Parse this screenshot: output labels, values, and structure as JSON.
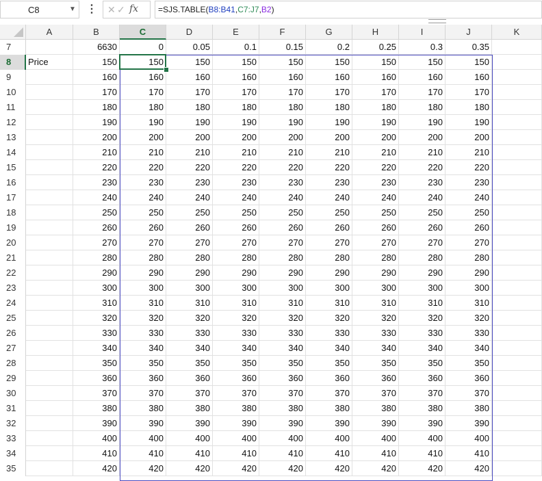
{
  "formula_bar": {
    "name_box": "C8",
    "cancel_glyph": "✕",
    "enter_glyph": "✓",
    "fx_label": "fx",
    "formula_prefix": "=SJS.TABLE(",
    "formula_ref1": "B8:B41",
    "formula_sep1": ",",
    "formula_ref2": "C7:J7",
    "formula_sep2": ",",
    "formula_ref3": "B2",
    "formula_suffix": ")"
  },
  "sheet": {
    "columns": [
      "A",
      "B",
      "C",
      "D",
      "E",
      "F",
      "G",
      "H",
      "I",
      "J",
      "K"
    ],
    "selected_column": "C",
    "selected_row": 8,
    "header_row": {
      "row": 7,
      "B": "6630",
      "C_to_J": [
        "0",
        "0.05",
        "0.1",
        "0.15",
        "0.2",
        "0.25",
        "0.3",
        "0.35"
      ]
    },
    "a8_label": "Price",
    "rows": [
      {
        "row": 8,
        "value": "150"
      },
      {
        "row": 9,
        "value": "160"
      },
      {
        "row": 10,
        "value": "170"
      },
      {
        "row": 11,
        "value": "180"
      },
      {
        "row": 12,
        "value": "190"
      },
      {
        "row": 13,
        "value": "200"
      },
      {
        "row": 14,
        "value": "210"
      },
      {
        "row": 15,
        "value": "220"
      },
      {
        "row": 16,
        "value": "230"
      },
      {
        "row": 17,
        "value": "240"
      },
      {
        "row": 18,
        "value": "250"
      },
      {
        "row": 19,
        "value": "260"
      },
      {
        "row": 20,
        "value": "270"
      },
      {
        "row": 21,
        "value": "280"
      },
      {
        "row": 22,
        "value": "290"
      },
      {
        "row": 23,
        "value": "300"
      },
      {
        "row": 24,
        "value": "310"
      },
      {
        "row": 25,
        "value": "320"
      },
      {
        "row": 26,
        "value": "330"
      },
      {
        "row": 27,
        "value": "340"
      },
      {
        "row": 28,
        "value": "350"
      },
      {
        "row": 29,
        "value": "360"
      },
      {
        "row": 30,
        "value": "370"
      },
      {
        "row": 31,
        "value": "380"
      },
      {
        "row": 32,
        "value": "390"
      },
      {
        "row": 33,
        "value": "400"
      },
      {
        "row": 34,
        "value": "410"
      },
      {
        "row": 35,
        "value": "420"
      }
    ]
  },
  "colors": {
    "accent_green": "#217346",
    "range_blue": "#4a4abf"
  }
}
